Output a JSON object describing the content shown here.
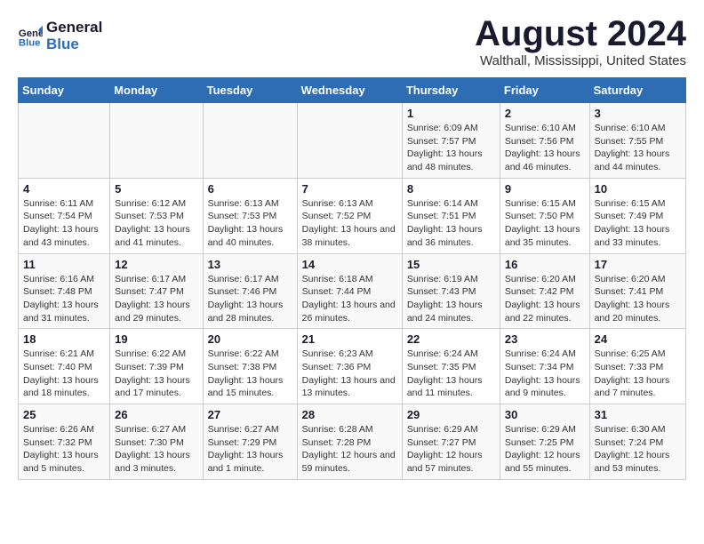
{
  "header": {
    "logo_line1": "General",
    "logo_line2": "Blue",
    "main_title": "August 2024",
    "subtitle": "Walthall, Mississippi, United States"
  },
  "calendar": {
    "weekdays": [
      "Sunday",
      "Monday",
      "Tuesday",
      "Wednesday",
      "Thursday",
      "Friday",
      "Saturday"
    ],
    "weeks": [
      [
        {
          "day": "",
          "sunrise": "",
          "sunset": "",
          "daylight": ""
        },
        {
          "day": "",
          "sunrise": "",
          "sunset": "",
          "daylight": ""
        },
        {
          "day": "",
          "sunrise": "",
          "sunset": "",
          "daylight": ""
        },
        {
          "day": "",
          "sunrise": "",
          "sunset": "",
          "daylight": ""
        },
        {
          "day": "1",
          "sunrise": "Sunrise: 6:09 AM",
          "sunset": "Sunset: 7:57 PM",
          "daylight": "Daylight: 13 hours and 48 minutes."
        },
        {
          "day": "2",
          "sunrise": "Sunrise: 6:10 AM",
          "sunset": "Sunset: 7:56 PM",
          "daylight": "Daylight: 13 hours and 46 minutes."
        },
        {
          "day": "3",
          "sunrise": "Sunrise: 6:10 AM",
          "sunset": "Sunset: 7:55 PM",
          "daylight": "Daylight: 13 hours and 44 minutes."
        }
      ],
      [
        {
          "day": "4",
          "sunrise": "Sunrise: 6:11 AM",
          "sunset": "Sunset: 7:54 PM",
          "daylight": "Daylight: 13 hours and 43 minutes."
        },
        {
          "day": "5",
          "sunrise": "Sunrise: 6:12 AM",
          "sunset": "Sunset: 7:53 PM",
          "daylight": "Daylight: 13 hours and 41 minutes."
        },
        {
          "day": "6",
          "sunrise": "Sunrise: 6:13 AM",
          "sunset": "Sunset: 7:53 PM",
          "daylight": "Daylight: 13 hours and 40 minutes."
        },
        {
          "day": "7",
          "sunrise": "Sunrise: 6:13 AM",
          "sunset": "Sunset: 7:52 PM",
          "daylight": "Daylight: 13 hours and 38 minutes."
        },
        {
          "day": "8",
          "sunrise": "Sunrise: 6:14 AM",
          "sunset": "Sunset: 7:51 PM",
          "daylight": "Daylight: 13 hours and 36 minutes."
        },
        {
          "day": "9",
          "sunrise": "Sunrise: 6:15 AM",
          "sunset": "Sunset: 7:50 PM",
          "daylight": "Daylight: 13 hours and 35 minutes."
        },
        {
          "day": "10",
          "sunrise": "Sunrise: 6:15 AM",
          "sunset": "Sunset: 7:49 PM",
          "daylight": "Daylight: 13 hours and 33 minutes."
        }
      ],
      [
        {
          "day": "11",
          "sunrise": "Sunrise: 6:16 AM",
          "sunset": "Sunset: 7:48 PM",
          "daylight": "Daylight: 13 hours and 31 minutes."
        },
        {
          "day": "12",
          "sunrise": "Sunrise: 6:17 AM",
          "sunset": "Sunset: 7:47 PM",
          "daylight": "Daylight: 13 hours and 29 minutes."
        },
        {
          "day": "13",
          "sunrise": "Sunrise: 6:17 AM",
          "sunset": "Sunset: 7:46 PM",
          "daylight": "Daylight: 13 hours and 28 minutes."
        },
        {
          "day": "14",
          "sunrise": "Sunrise: 6:18 AM",
          "sunset": "Sunset: 7:44 PM",
          "daylight": "Daylight: 13 hours and 26 minutes."
        },
        {
          "day": "15",
          "sunrise": "Sunrise: 6:19 AM",
          "sunset": "Sunset: 7:43 PM",
          "daylight": "Daylight: 13 hours and 24 minutes."
        },
        {
          "day": "16",
          "sunrise": "Sunrise: 6:20 AM",
          "sunset": "Sunset: 7:42 PM",
          "daylight": "Daylight: 13 hours and 22 minutes."
        },
        {
          "day": "17",
          "sunrise": "Sunrise: 6:20 AM",
          "sunset": "Sunset: 7:41 PM",
          "daylight": "Daylight: 13 hours and 20 minutes."
        }
      ],
      [
        {
          "day": "18",
          "sunrise": "Sunrise: 6:21 AM",
          "sunset": "Sunset: 7:40 PM",
          "daylight": "Daylight: 13 hours and 18 minutes."
        },
        {
          "day": "19",
          "sunrise": "Sunrise: 6:22 AM",
          "sunset": "Sunset: 7:39 PM",
          "daylight": "Daylight: 13 hours and 17 minutes."
        },
        {
          "day": "20",
          "sunrise": "Sunrise: 6:22 AM",
          "sunset": "Sunset: 7:38 PM",
          "daylight": "Daylight: 13 hours and 15 minutes."
        },
        {
          "day": "21",
          "sunrise": "Sunrise: 6:23 AM",
          "sunset": "Sunset: 7:36 PM",
          "daylight": "Daylight: 13 hours and 13 minutes."
        },
        {
          "day": "22",
          "sunrise": "Sunrise: 6:24 AM",
          "sunset": "Sunset: 7:35 PM",
          "daylight": "Daylight: 13 hours and 11 minutes."
        },
        {
          "day": "23",
          "sunrise": "Sunrise: 6:24 AM",
          "sunset": "Sunset: 7:34 PM",
          "daylight": "Daylight: 13 hours and 9 minutes."
        },
        {
          "day": "24",
          "sunrise": "Sunrise: 6:25 AM",
          "sunset": "Sunset: 7:33 PM",
          "daylight": "Daylight: 13 hours and 7 minutes."
        }
      ],
      [
        {
          "day": "25",
          "sunrise": "Sunrise: 6:26 AM",
          "sunset": "Sunset: 7:32 PM",
          "daylight": "Daylight: 13 hours and 5 minutes."
        },
        {
          "day": "26",
          "sunrise": "Sunrise: 6:27 AM",
          "sunset": "Sunset: 7:30 PM",
          "daylight": "Daylight: 13 hours and 3 minutes."
        },
        {
          "day": "27",
          "sunrise": "Sunrise: 6:27 AM",
          "sunset": "Sunset: 7:29 PM",
          "daylight": "Daylight: 13 hours and 1 minute."
        },
        {
          "day": "28",
          "sunrise": "Sunrise: 6:28 AM",
          "sunset": "Sunset: 7:28 PM",
          "daylight": "Daylight: 12 hours and 59 minutes."
        },
        {
          "day": "29",
          "sunrise": "Sunrise: 6:29 AM",
          "sunset": "Sunset: 7:27 PM",
          "daylight": "Daylight: 12 hours and 57 minutes."
        },
        {
          "day": "30",
          "sunrise": "Sunrise: 6:29 AM",
          "sunset": "Sunset: 7:25 PM",
          "daylight": "Daylight: 12 hours and 55 minutes."
        },
        {
          "day": "31",
          "sunrise": "Sunrise: 6:30 AM",
          "sunset": "Sunset: 7:24 PM",
          "daylight": "Daylight: 12 hours and 53 minutes."
        }
      ]
    ]
  }
}
